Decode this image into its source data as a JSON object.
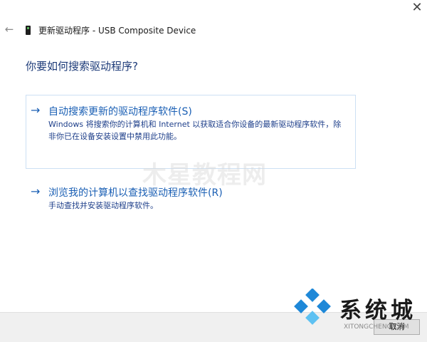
{
  "window": {
    "title": "更新驱动程序 - USB Composite Device",
    "back_symbol": "←",
    "close_symbol": "✕"
  },
  "heading": "你要如何搜索驱动程序?",
  "options": [
    {
      "arrow": "→",
      "title": "自动搜索更新的驱动程序软件(S)",
      "description": "Windows 将搜索你的计算机和 Internet 以获取适合你设备的最新驱动程序软件，除非你已在设备安装设置中禁用此功能。"
    },
    {
      "arrow": "→",
      "title": "浏览我的计算机以查找驱动程序软件(R)",
      "description": "手动查找并安装驱动程序软件。"
    }
  ],
  "footer": {
    "cancel_label": "取消"
  },
  "watermarks": {
    "center_text": "木星教程网",
    "logo_text": "系统城",
    "logo_url": "XITONGCHENG.COM"
  },
  "colors": {
    "link": "#1a5fb4",
    "heading": "#1c3a78",
    "selected_border": "#cce0f4",
    "footer_bg": "#f0f0f0",
    "logo_blue": "#1e88d8",
    "logo_light": "#5ec1f2"
  },
  "icons": {
    "back": "back-arrow-icon",
    "close": "close-icon",
    "device": "usb-device-icon",
    "option_arrow": "right-arrow-icon",
    "logo": "diamond-logo-icon"
  }
}
